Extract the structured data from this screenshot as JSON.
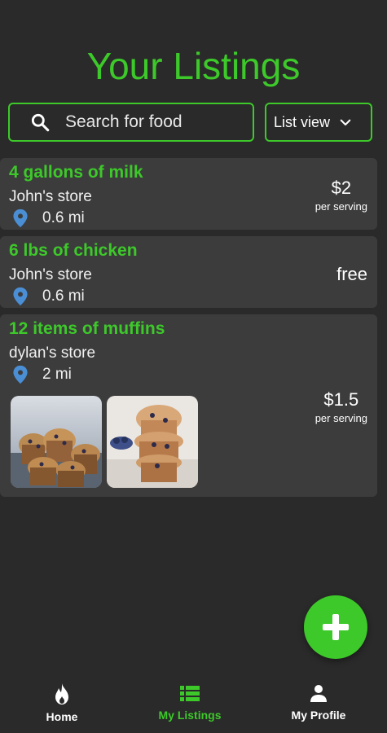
{
  "header": {
    "title": "Your Listings"
  },
  "search": {
    "placeholder": "Search for food",
    "icon": "search-icon"
  },
  "view_select": {
    "value": "List view",
    "icon": "chevron-down-icon"
  },
  "listings": [
    {
      "title": "4 gallons of milk",
      "store": "John's store",
      "distance": "0.6 mi",
      "price": "$2",
      "price_unit": "per serving"
    },
    {
      "title": "6 lbs of chicken",
      "store": "John's store",
      "distance": "0.6 mi",
      "price": "free"
    },
    {
      "title": "12 items of muffins",
      "store": "dylan's store",
      "distance": "2 mi",
      "price": "$1.5",
      "price_unit": "per serving"
    }
  ],
  "fab": {
    "icon": "plus-icon"
  },
  "nav": [
    {
      "label": "Home",
      "icon": "flame-icon",
      "active": false
    },
    {
      "label": "My Listings",
      "icon": "list-icon",
      "active": true
    },
    {
      "label": "My Profile",
      "icon": "person-icon",
      "active": false
    }
  ],
  "colors": {
    "accent": "#3dc92a",
    "background": "#2a2a2a",
    "card": "#3c3c3c",
    "pin": "#4a8fd6"
  }
}
